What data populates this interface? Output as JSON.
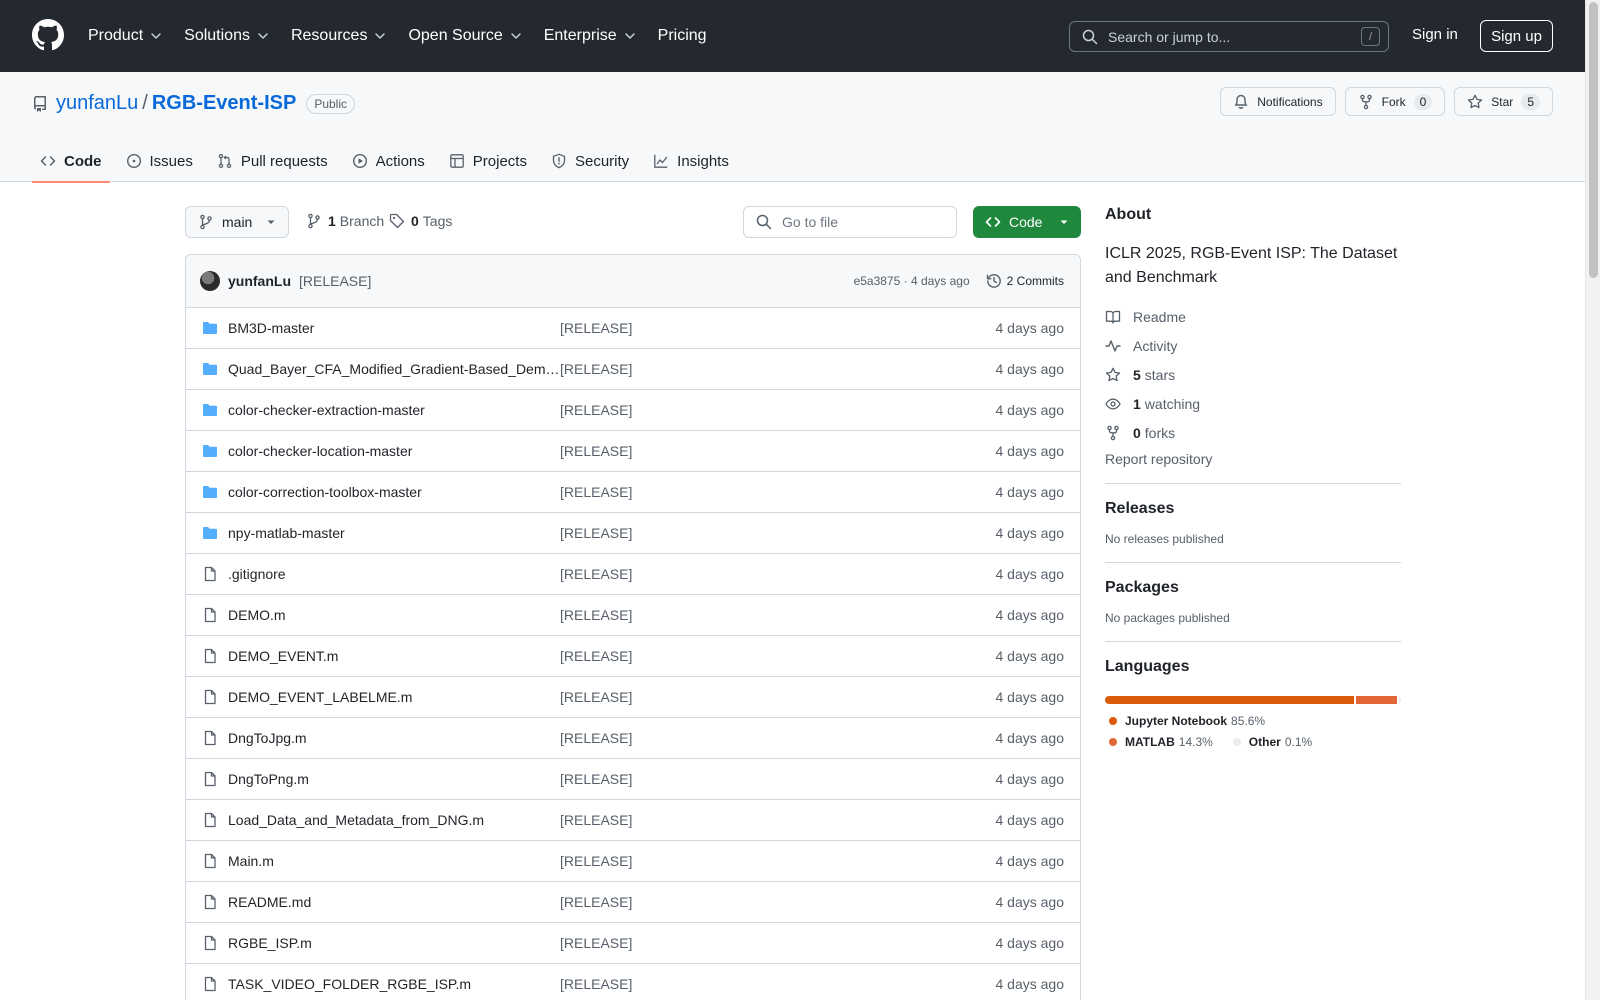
{
  "header": {
    "nav": [
      {
        "label": "Product",
        "dropdown": true
      },
      {
        "label": "Solutions",
        "dropdown": true
      },
      {
        "label": "Resources",
        "dropdown": true
      },
      {
        "label": "Open Source",
        "dropdown": true
      },
      {
        "label": "Enterprise",
        "dropdown": true
      },
      {
        "label": "Pricing",
        "dropdown": false
      }
    ],
    "search_placeholder": "Search or jump to...",
    "search_key": "/",
    "signin": "Sign in",
    "signup": "Sign up"
  },
  "repo": {
    "owner": "yunfanLu",
    "separator": "/",
    "name": "RGB-Event-ISP",
    "visibility": "Public",
    "notifications_label": "Notifications",
    "fork_label": "Fork",
    "fork_count": "0",
    "star_label": "Star",
    "star_count": "5",
    "tabs": [
      {
        "label": "Code",
        "icon": "code-icon",
        "active": true
      },
      {
        "label": "Issues",
        "icon": "issue-icon",
        "active": false
      },
      {
        "label": "Pull requests",
        "icon": "pull-request-icon",
        "active": false
      },
      {
        "label": "Actions",
        "icon": "play-icon",
        "active": false
      },
      {
        "label": "Projects",
        "icon": "table-icon",
        "active": false
      },
      {
        "label": "Security",
        "icon": "shield-icon",
        "active": false
      },
      {
        "label": "Insights",
        "icon": "graph-icon",
        "active": false
      }
    ]
  },
  "branchbar": {
    "branch": "main",
    "branch_count": "1",
    "branch_label": "Branch",
    "tag_count": "0",
    "tag_label": "Tags",
    "goto_placeholder": "Go to file",
    "code_label": "Code"
  },
  "commit": {
    "author": "yunfanLu",
    "message": "[RELEASE]",
    "meta": "e5a3875 · 4 days ago",
    "commits": "2 Commits"
  },
  "files": [
    {
      "name": "BM3D-master",
      "type": "dir",
      "message": "[RELEASE]",
      "date": "4 days ago"
    },
    {
      "name": "Quad_Bayer_CFA_Modified_Gradient-Based_Demosaicing",
      "type": "dir",
      "message": "[RELEASE]",
      "date": "4 days ago"
    },
    {
      "name": "color-checker-extraction-master",
      "type": "dir",
      "message": "[RELEASE]",
      "date": "4 days ago"
    },
    {
      "name": "color-checker-location-master",
      "type": "dir",
      "message": "[RELEASE]",
      "date": "4 days ago"
    },
    {
      "name": "color-correction-toolbox-master",
      "type": "dir",
      "message": "[RELEASE]",
      "date": "4 days ago"
    },
    {
      "name": "npy-matlab-master",
      "type": "dir",
      "message": "[RELEASE]",
      "date": "4 days ago"
    },
    {
      "name": ".gitignore",
      "type": "file",
      "message": "[RELEASE]",
      "date": "4 days ago"
    },
    {
      "name": "DEMO.m",
      "type": "file",
      "message": "[RELEASE]",
      "date": "4 days ago"
    },
    {
      "name": "DEMO_EVENT.m",
      "type": "file",
      "message": "[RELEASE]",
      "date": "4 days ago"
    },
    {
      "name": "DEMO_EVENT_LABELME.m",
      "type": "file",
      "message": "[RELEASE]",
      "date": "4 days ago"
    },
    {
      "name": "DngToJpg.m",
      "type": "file",
      "message": "[RELEASE]",
      "date": "4 days ago"
    },
    {
      "name": "DngToPng.m",
      "type": "file",
      "message": "[RELEASE]",
      "date": "4 days ago"
    },
    {
      "name": "Load_Data_and_Metadata_from_DNG.m",
      "type": "file",
      "message": "[RELEASE]",
      "date": "4 days ago"
    },
    {
      "name": "Main.m",
      "type": "file",
      "message": "[RELEASE]",
      "date": "4 days ago"
    },
    {
      "name": "README.md",
      "type": "file",
      "message": "[RELEASE]",
      "date": "4 days ago"
    },
    {
      "name": "RGBE_ISP.m",
      "type": "file",
      "message": "[RELEASE]",
      "date": "4 days ago"
    },
    {
      "name": "TASK_VIDEO_FOLDER_RGBE_ISP.m",
      "type": "file",
      "message": "[RELEASE]",
      "date": "4 days ago"
    }
  ],
  "about": {
    "title": "About",
    "description": "ICLR 2025, RGB-Event ISP: The Dataset and Benchmark",
    "links": [
      {
        "icon": "book-icon",
        "count": "",
        "label": "Readme"
      },
      {
        "icon": "pulse-icon",
        "count": "",
        "label": "Activity"
      },
      {
        "icon": "star-icon",
        "count": "5",
        "label": "stars"
      },
      {
        "icon": "eye-icon",
        "count": "1",
        "label": "watching"
      },
      {
        "icon": "fork-icon",
        "count": "0",
        "label": "forks"
      }
    ],
    "report": "Report repository"
  },
  "releases": {
    "title": "Releases",
    "note": "No releases published"
  },
  "packages": {
    "title": "Packages",
    "note": "No packages published"
  },
  "languages": {
    "title": "Languages",
    "items": [
      {
        "name": "Jupyter Notebook",
        "percent": "85.6%",
        "value": 85.6,
        "color": "#DA5B0B"
      },
      {
        "name": "MATLAB",
        "percent": "14.3%",
        "value": 14.3,
        "color": "#e16737"
      },
      {
        "name": "Other",
        "percent": "0.1%",
        "value": 0.1,
        "color": "#ededed"
      }
    ]
  },
  "colors": {
    "header_bg": "#24292f",
    "accent_link": "#0969da",
    "code_button": "#1f883d",
    "tab_underline": "#fd8c73",
    "folder_icon": "#54aeff"
  }
}
